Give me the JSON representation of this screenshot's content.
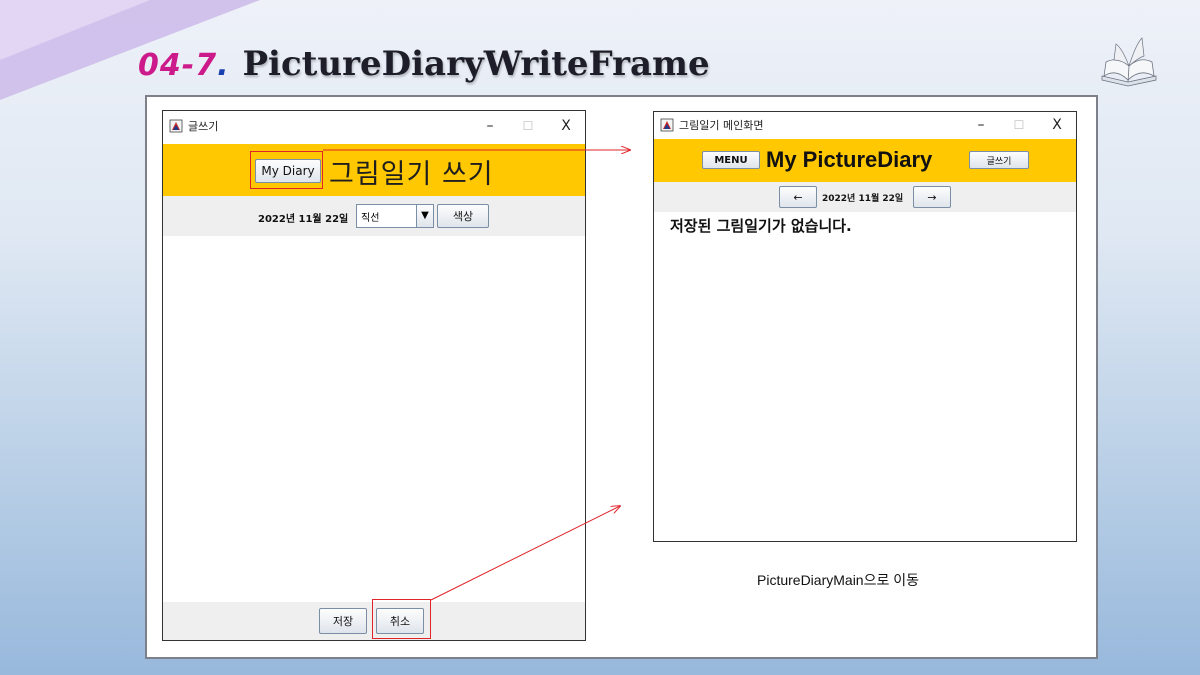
{
  "slide": {
    "number": "04-7",
    "separator": ".",
    "title": "PictureDiaryWriteFrame",
    "caption": "PictureDiaryMain으로 이동"
  },
  "write_frame": {
    "window_title": "글쓰기",
    "controls": {
      "minimize": "–",
      "maximize": "☐",
      "close": "X"
    },
    "diary_button": "My Diary",
    "header_title": "그림일기 쓰기",
    "date": "2022년  11월  22일",
    "shape_select": "직선",
    "color_button": "색상",
    "save_button": "저장",
    "cancel_button": "취소"
  },
  "main_frame": {
    "window_title": "그림일기 메인화면",
    "controls": {
      "minimize": "–",
      "maximize": "☐",
      "close": "X"
    },
    "menu_button": "MENU",
    "header_title": "My PictureDiary",
    "write_button": "글쓰기",
    "prev_button": "←",
    "date": "2022년 11월 22일",
    "next_button": "→",
    "empty_message": "저장된 그림일기가 없습니다."
  },
  "colors": {
    "header_yellow": "#ffc800",
    "highlight_red": "#e0242a",
    "title_number": "#cc1a8a"
  },
  "icons": [
    "java-app-icon",
    "open-book-icon"
  ]
}
